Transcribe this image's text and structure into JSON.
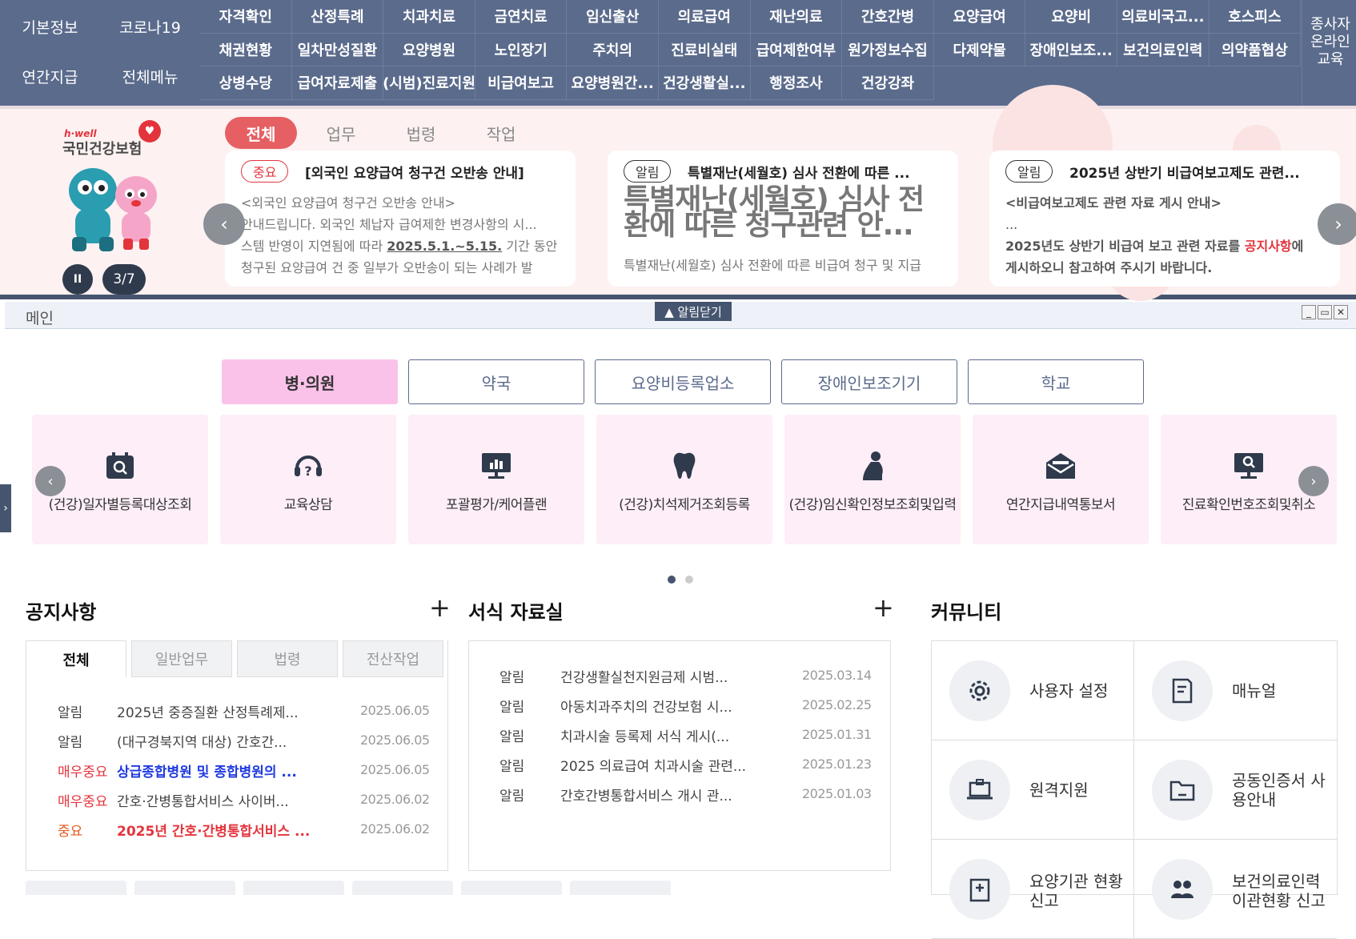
{
  "topnav": {
    "side": [
      "기본정보",
      "코로나19",
      "연간지급",
      "전체메뉴"
    ],
    "menu_rows": [
      [
        "자격확인",
        "산정특례",
        "치과치료",
        "금연치료",
        "임신출산",
        "의료급여",
        "재난의료",
        "간호간병",
        "요양급여",
        "요양비",
        "의료비국고...",
        "호스피스"
      ],
      [
        "채권현황",
        "일차만성질환",
        "요양병원",
        "노인장기",
        "주치의",
        "진료비실태",
        "급여제한여부",
        "원가정보수집",
        "다제약물",
        "장애인보조...",
        "보건의료인력",
        "의약품협상"
      ],
      [
        "상병수당",
        "급여자료제출",
        "(시범)진료지원",
        "비급여보고",
        "요양병원간...",
        "건강생활실...",
        "행정조사",
        "건강강좌"
      ]
    ],
    "edu_lines": [
      "종사자",
      "온라인",
      "교육"
    ]
  },
  "banner": {
    "logo_small": "h·well",
    "logo": "국민건강보험",
    "logo_heart": "♥",
    "pause_icon": "II",
    "counter": "3/7",
    "prev_arrow": "‹",
    "next_arrow": "›",
    "tabs": [
      "전체",
      "업무",
      "법령",
      "작업"
    ],
    "cards": [
      {
        "badge": "중요",
        "title": "[외국인 요양급여 청구건 오반송 안내]",
        "lines": [
          "<외국인 요양급여 청구건 오반송 안내>",
          "안내드립니다. 외국인 체납자 급여제한 변경사항의 시...",
          "스템 반영이 지연됨에 따라 ",
          "2025.5.1.~5.15.",
          " 기간 동안",
          "청구된 요양급여 건 중 일부가 오반송이 되는 사례가 발"
        ]
      },
      {
        "badge": "알림",
        "title": "특별재난(세월호) 심사 전환에 따른 ...",
        "big": "특별재난(세월호) 심사 전환에 따른 청구관련 안...",
        "foot": "특별재난(세월호) 심사 전환에 따른 비급여 청구 및 지급"
      },
      {
        "badge": "알림",
        "title": "2025년 상반기 비급여보고제도 관련...",
        "line1": "<비급여보고제도 관련 자료 게시 안내>",
        "line2": "...",
        "line3a": "2025년도 상반기 비급여 보고 관련 자료를 ",
        "line3b": "공지사항",
        "line3c": "에",
        "line4": "게시하오니 참고하여 주시기 바랍니다."
      }
    ]
  },
  "mainbar": {
    "title": "메인",
    "close_alert": "▲ 알림닫기",
    "controls": [
      "_",
      "▭",
      "✕"
    ],
    "left_tab": "›"
  },
  "categories": [
    "병·의원",
    "약국",
    "요양비등록업소",
    "장애인보조기기",
    "학교"
  ],
  "quick": {
    "prev": "‹",
    "next": "›",
    "items": [
      {
        "label": "(건강)일자별등록대상조회",
        "icon": "calendar-search-icon"
      },
      {
        "label": "교육상담",
        "icon": "headset-icon"
      },
      {
        "label": "포괄평가/케어플랜",
        "icon": "chart-board-icon"
      },
      {
        "label": "(건강)치석제거조회등록",
        "icon": "tooth-icon"
      },
      {
        "label": "(건강)임신확인정보조회및입력",
        "icon": "pregnant-icon"
      },
      {
        "label": "연간지급내역통보서",
        "icon": "mail-open-icon"
      },
      {
        "label": "진료확인번호조회및취소",
        "icon": "monitor-search-icon"
      }
    ]
  },
  "notice": {
    "title": "공지사항",
    "plus": "+",
    "tabs": [
      "전체",
      "일반업무",
      "법령",
      "전산작업"
    ],
    "rows": [
      {
        "tag": "알림",
        "tag_class": "",
        "text": "2025년 중증질환 산정특례제...",
        "text_class": "",
        "date": "2025.06.05"
      },
      {
        "tag": "알림",
        "tag_class": "",
        "text": "(대구경북지역 대상) 간호간...",
        "text_class": "",
        "date": "2025.06.05"
      },
      {
        "tag": "매우중요",
        "tag_class": "very",
        "text": "상급종합병원 및 종합병원의 ...",
        "text_class": "blue",
        "date": "2025.06.05"
      },
      {
        "tag": "매우중요",
        "tag_class": "very",
        "text": "간호·간병통합서비스 사이버...",
        "text_class": "",
        "date": "2025.06.02"
      },
      {
        "tag": "중요",
        "tag_class": "imp",
        "text": "2025년 간호·간병통합서비스 ...",
        "text_class": "red",
        "date": "2025.06.02"
      }
    ]
  },
  "forms": {
    "title": "서식 자료실",
    "plus": "+",
    "rows": [
      {
        "tag": "알림",
        "text": "건강생활실천지원금제 시범...",
        "date": "2025.03.14"
      },
      {
        "tag": "알림",
        "text": "아동치과주치의 건강보험 시...",
        "date": "2025.02.25"
      },
      {
        "tag": "알림",
        "text": "치과시술 등록제 서식 게시(...",
        "date": "2025.01.31"
      },
      {
        "tag": "알림",
        "text": "2025 의료급여 치과시술 관련...",
        "date": "2025.01.23"
      },
      {
        "tag": "알림",
        "text": "간호간병통합서비스 개시 관...",
        "date": "2025.01.03"
      }
    ]
  },
  "community": {
    "title": "커뮤니티",
    "items": [
      {
        "label": "사용자 설정",
        "icon": "gear-icon"
      },
      {
        "label": "매뉴얼",
        "icon": "document-icon"
      },
      {
        "label": "원격지원",
        "icon": "laptop-icon"
      },
      {
        "label": "공동인증서 사용안내",
        "icon": "folder-icon"
      },
      {
        "label": "요양기관 현황신고",
        "icon": "hospital-icon"
      },
      {
        "label": "보건의료인력 이관현황 신고",
        "icon": "people-icon"
      }
    ]
  }
}
